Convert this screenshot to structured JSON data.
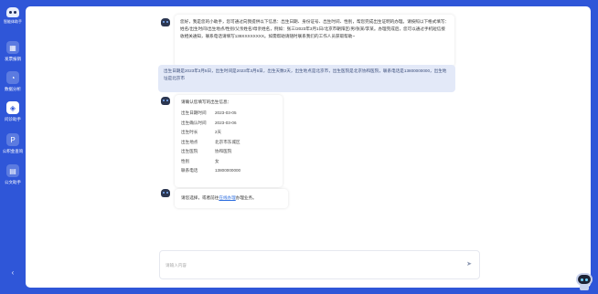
{
  "app": {
    "logo_text": "智能体助手"
  },
  "sidebar": {
    "items": [
      {
        "label": "发票报销",
        "icon": "receipt-icon",
        "glyph": "▦",
        "active": false
      },
      {
        "label": "数据分析",
        "icon": "chart-icon",
        "glyph": "◔",
        "active": false
      },
      {
        "label": "问诊助手",
        "icon": "robot-icon",
        "glyph": "◈",
        "active": true
      },
      {
        "label": "公积金查询",
        "icon": "fund-icon",
        "glyph": "P",
        "active": false
      },
      {
        "label": "公文助手",
        "icon": "document-icon",
        "glyph": "▤",
        "active": false
      }
    ],
    "collapse_glyph": "‹"
  },
  "chat": {
    "msg1": "您好，我是您的小助手，您可通过向我提供以下信息：出生日期、身份证号、出生时间、性别，帮您完成出生证明的办理。请按照以下格式填写：姓名/出生时间/出生地点/性别/父亲姓名/母亲姓名，例如：张三/2023年3月1日/北京市朝阳区/男/张某/李某。办理完成后，您可以通过手机短信接收相关通知，联系电话请填写138XXXXXXXX。如需帮助请随时联系我们的工作人员获取帮助~",
    "msg2": "出生日期是2023年3月5日，出生时间是2023年3月6日，出生天数2天，出生地点是北京市，出生医院是北京协和医院，联系电话是13800000000，出生地址是北京市",
    "msg3_head": "请确认您填写的出生信息：",
    "fields": [
      {
        "k": "出生日期时间",
        "v": "2023-03-05"
      },
      {
        "k": "出生确认时间",
        "v": "2023-03-06"
      },
      {
        "k": "出生时长",
        "v": "2天"
      },
      {
        "k": "出生地点",
        "v": "北京市东城区"
      },
      {
        "k": "出生医院",
        "v": "协和医院"
      },
      {
        "k": "性别",
        "v": "女"
      },
      {
        "k": "联系电话",
        "v": "13800000000"
      }
    ],
    "msg4_prefix": "请您选择，或者前往",
    "msg4_link": "在线办理",
    "msg4_suffix": "办理业务。"
  },
  "input": {
    "placeholder": "请输入内容",
    "send_glyph": "➤"
  }
}
